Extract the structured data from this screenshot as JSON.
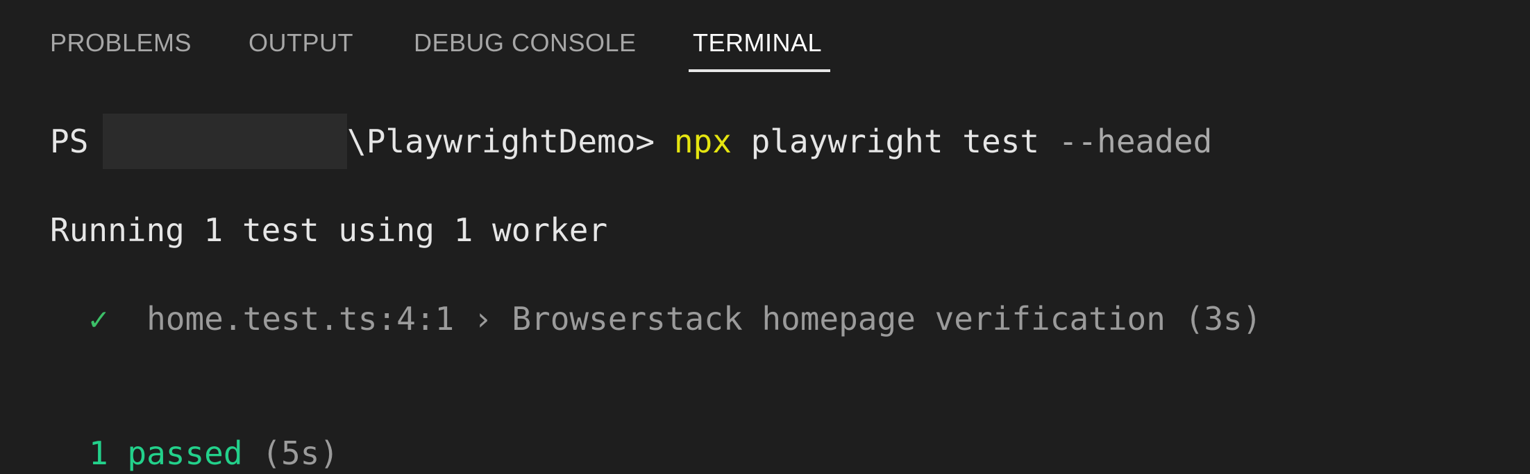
{
  "panel": {
    "tabs": [
      {
        "label": "PROBLEMS"
      },
      {
        "label": "OUTPUT"
      },
      {
        "label": "DEBUG CONSOLE"
      },
      {
        "label": "TERMINAL"
      }
    ],
    "active_tab": "TERMINAL"
  },
  "terminal": {
    "prompt": {
      "prefix": "PS",
      "path_suffix": "\\PlaywrightDemo>",
      "command": "npx",
      "args": "playwright test",
      "flag": "--headed"
    },
    "running_line": "Running 1 test using 1 worker",
    "test_result": {
      "check": "✓",
      "file_location": "home.test.ts:4:1",
      "separator": "›",
      "title": "Browserstack homepage verification",
      "duration": "(3s)"
    },
    "summary": {
      "passed": "1 passed",
      "duration": "(5s)"
    }
  },
  "colors": {
    "background": "#1e1e1e",
    "command": "#e5e510",
    "success": "#23d18b",
    "inactive_tab": "#a7a7a7"
  }
}
